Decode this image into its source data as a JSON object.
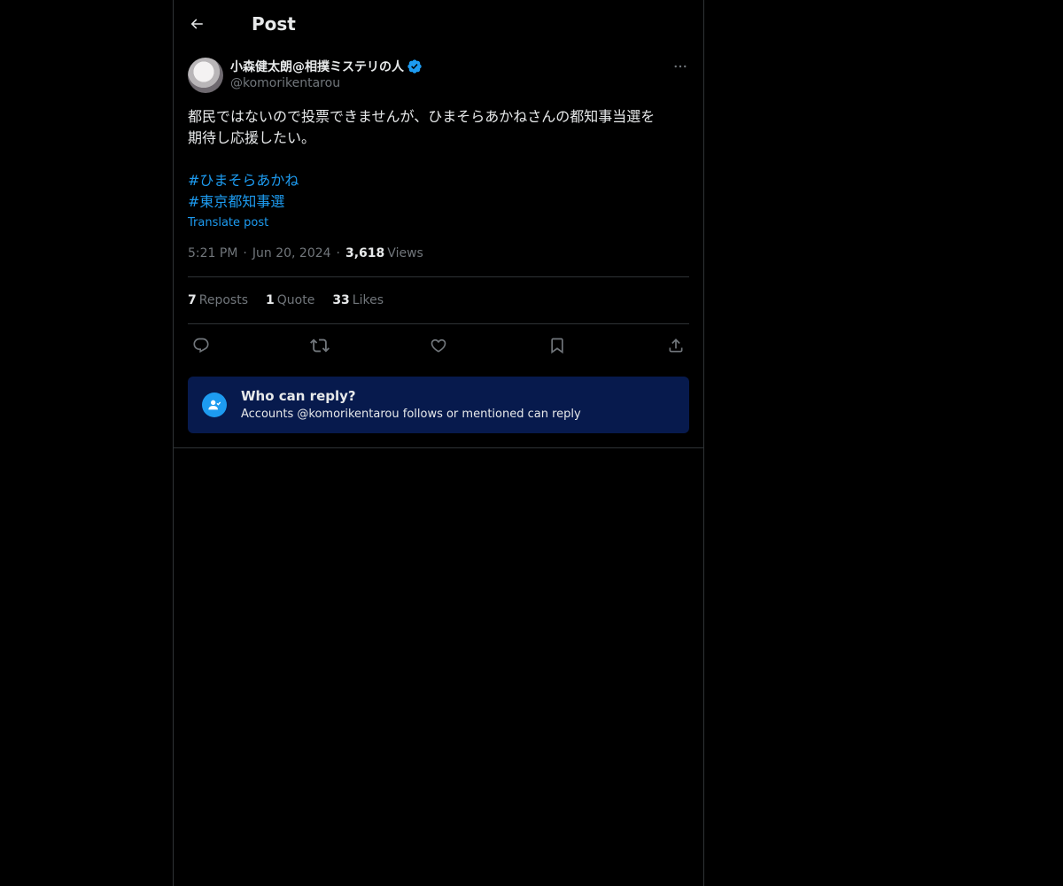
{
  "header": {
    "back_icon": "arrow-left-icon",
    "title": "Post"
  },
  "author": {
    "display_name": "小森健太朗@相撲ミステリの人",
    "handle": "@komorikentarou",
    "verified_icon": "verified-badge-icon",
    "more_icon": "more-horizontal-icon"
  },
  "post": {
    "text": "都民ではないので投票できませんが、ひまそらあかねさんの都知事当選を\n期待し応援したい。",
    "hashtags": [
      "#ひまそらあかね",
      "#東京都知事選"
    ],
    "translate_label": "Translate post",
    "time": "5:21 PM",
    "date": "Jun 20, 2024",
    "separator": "·",
    "views_count": "3,618",
    "views_label": "Views"
  },
  "stats": [
    {
      "count": "7",
      "label": "Reposts"
    },
    {
      "count": "1",
      "label": "Quote"
    },
    {
      "count": "33",
      "label": "Likes"
    }
  ],
  "actions": [
    "reply-icon",
    "repost-icon",
    "like-icon",
    "bookmark-icon",
    "share-icon"
  ],
  "who_can_reply": {
    "icon": "mention-user-icon",
    "title": "Who can reply?",
    "subtitle": "Accounts @komorikentarou follows or mentioned can reply"
  },
  "colors": {
    "background": "#000000",
    "accent": "#1d9bf0",
    "muted": "#71767b",
    "text": "#e7e9ea",
    "border": "#2f3336",
    "reply_box": "#071a4d"
  }
}
